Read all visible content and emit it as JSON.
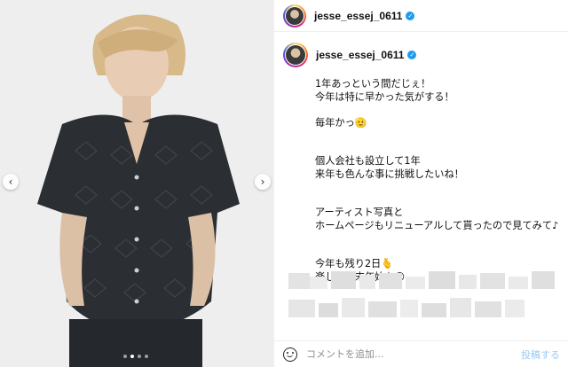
{
  "post": {
    "username": "jesse_essej_0611",
    "verified_icon": "verified-badge-icon",
    "caption_lines": [
      "1年あっという間だじぇ！",
      "今年は特に早かった気がする！",
      "",
      "毎年かっ🫡",
      "",
      "",
      "個人会社も設立して1年",
      "来年も色んな事に挑戦したいね！",
      "",
      "",
      "アーティスト写真と",
      "ホームページもリニューアルして貰ったので見てみて♪",
      "",
      "",
      "今年も残り2日🫰",
      "楽しい年末年始を😊"
    ]
  },
  "carousel": {
    "prev_icon": "‹",
    "next_icon": "›",
    "slide_count": 4,
    "active_index": 1
  },
  "comment_bar": {
    "placeholder": "コメントを追加...",
    "post_label": "投稿する"
  },
  "colors": {
    "accent": "#1d9bf0",
    "post_button": "#9bc9f5",
    "border": "#efefef"
  }
}
